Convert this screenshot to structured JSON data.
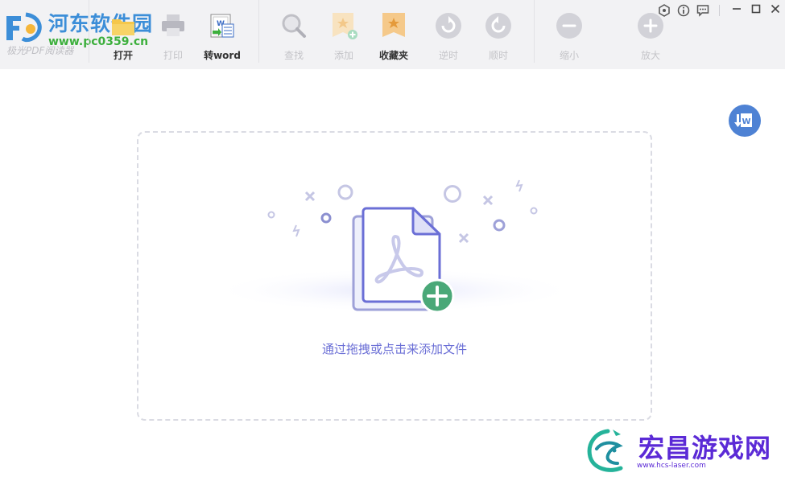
{
  "logo": {
    "site_name": "河东软件园",
    "site_url": "www.pc0359.cn",
    "app_name": "极光PDF阅读器"
  },
  "toolbar": {
    "open": "打开",
    "print": "打印",
    "to_word": "转word",
    "find": "查找",
    "add": "添加",
    "favorites": "收藏夹",
    "rotate_ccw": "逆时",
    "rotate_cw": "顺时",
    "zoom_out": "缩小",
    "zoom_in": "放大"
  },
  "dropzone": {
    "hint": "通过拖拽或点击来添加文件"
  },
  "watermark": {
    "name": "宏昌游戏网",
    "url": "www.hcs-laser.com"
  },
  "colors": {
    "accent": "#6b6fd6",
    "add_badge": "#4aa878",
    "toolbar_bg": "#f2f2f4",
    "word_fab": "#4e82d4"
  }
}
